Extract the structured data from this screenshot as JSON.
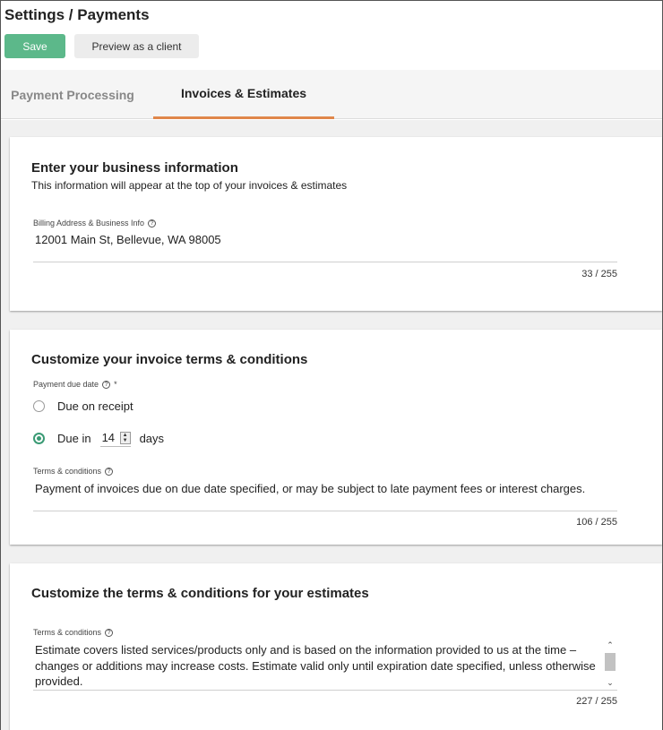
{
  "header": {
    "title": "Settings / Payments",
    "save_label": "Save",
    "preview_label": "Preview as a client"
  },
  "tabs": [
    {
      "label": "Payment Processing",
      "active": false
    },
    {
      "label": "Invoices & Estimates",
      "active": true
    }
  ],
  "business_info": {
    "title": "Enter your business information",
    "subtitle": "This information will appear at the top of your invoices & estimates",
    "field_label": "Billing Address & Business Info",
    "value": "12001 Main St, Bellevue, WA 98005",
    "counter": "33 / 255"
  },
  "invoice_terms": {
    "title": "Customize your invoice terms & conditions",
    "due_label": "Payment due date",
    "required_mark": "*",
    "option_receipt": "Due on receipt",
    "option_due_in": "Due in",
    "due_days": "14",
    "days_label": "days",
    "terms_label": "Terms & conditions",
    "terms_value": "Payment of invoices due on due date specified, or may be subject to late payment fees or interest charges.",
    "counter": "106 / 255"
  },
  "estimate_terms": {
    "title": "Customize the terms & conditions for your estimates",
    "terms_label": "Terms & conditions",
    "terms_value": "Estimate covers listed services/products only and is based on the information provided to us at the time – changes or additions may increase costs. Estimate valid only until expiration date specified, unless otherwise provided.",
    "counter": "227 / 255"
  },
  "colors": {
    "accent_green": "#5cb88a",
    "tab_underline": "#e0874a",
    "radio_green": "#3a9a74"
  }
}
